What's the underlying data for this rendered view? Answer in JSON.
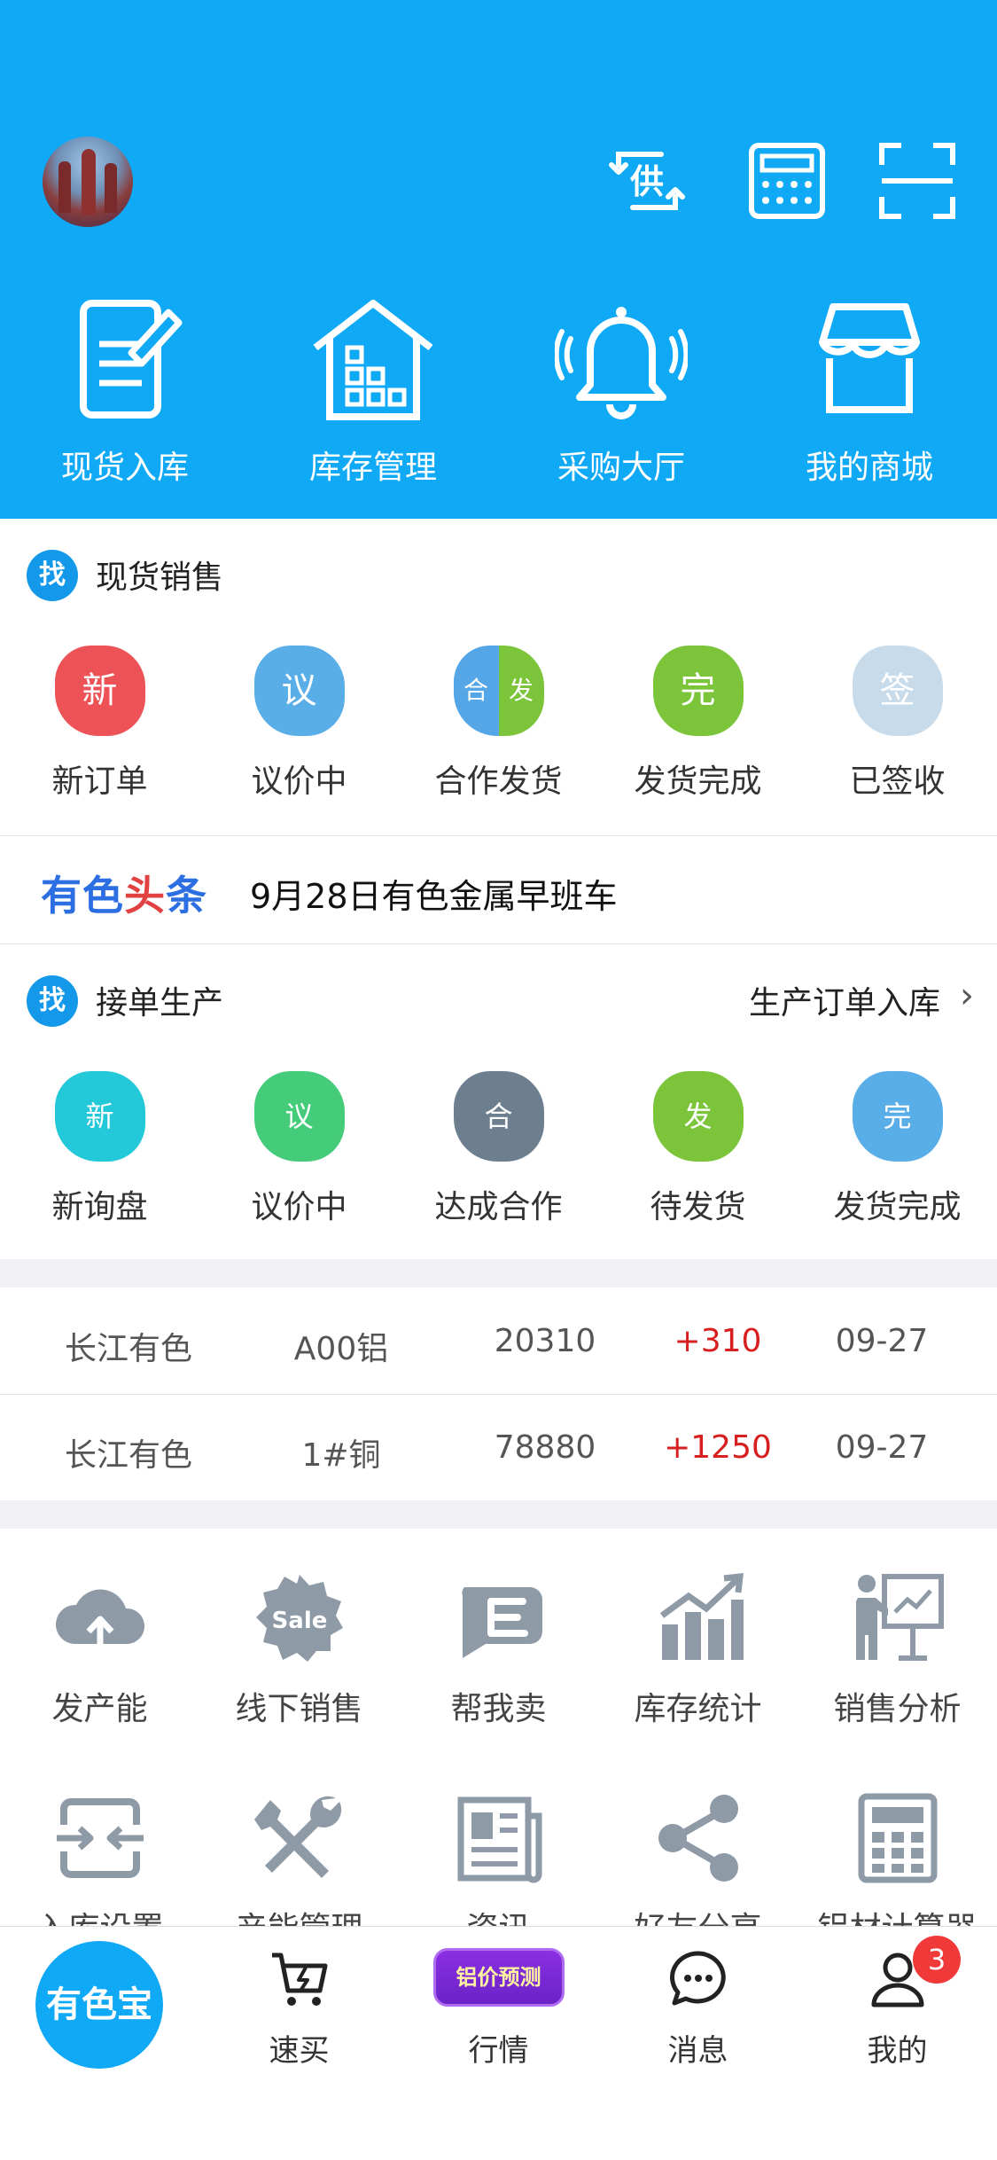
{
  "header": {
    "avatar_alt": "avatar",
    "icons": {
      "supply": "supply-swap-icon",
      "calculator": "calculator-icon",
      "scan": "scan-icon",
      "supply_char": "供"
    },
    "quick_actions": [
      {
        "label": "现货入库",
        "icon": "edit-document-icon"
      },
      {
        "label": "库存管理",
        "icon": "warehouse-icon"
      },
      {
        "label": "采购大厅",
        "icon": "bell-icon"
      },
      {
        "label": "我的商城",
        "icon": "shop-icon"
      }
    ]
  },
  "spot_sales": {
    "badge": "找",
    "title": "现货销售",
    "statuses": [
      {
        "glyph": "新",
        "label": "新订单",
        "color": "#ed5257"
      },
      {
        "glyph": "议",
        "label": "议价中",
        "color": "#59aee8"
      },
      {
        "glyph_left": "合",
        "glyph_right": "发",
        "label": "合作发货"
      },
      {
        "glyph": "完",
        "label": "发货完成",
        "color": "#7cc43a"
      },
      {
        "glyph": "签",
        "label": "已签收",
        "color": "#c8dbea"
      }
    ]
  },
  "news": {
    "logo_a": "有色",
    "logo_b": "头",
    "logo_c": "条",
    "headline": "9月28日有色金属早班车"
  },
  "production": {
    "badge": "找",
    "title": "接单生产",
    "link": "生产订单入库",
    "chevron": "›",
    "statuses": [
      {
        "glyph": "新",
        "label": "新询盘",
        "color": "#23c9d8"
      },
      {
        "glyph": "议",
        "label": "议价中",
        "color": "#45cc7b"
      },
      {
        "glyph": "合",
        "label": "达成合作",
        "color": "#6d7f8f"
      },
      {
        "glyph": "发",
        "label": "待发货",
        "color": "#7cc43a"
      },
      {
        "glyph": "完",
        "label": "发货完成",
        "color": "#59aee8"
      }
    ]
  },
  "prices": [
    {
      "source": "长江有色",
      "metal": "A00铝",
      "price": "20310",
      "change": "+310",
      "date": "09-27"
    },
    {
      "source": "长江有色",
      "metal": "1#铜",
      "price": "78880",
      "change": "+1250",
      "date": "09-27"
    }
  ],
  "tools": [
    {
      "label": "发产能",
      "icon": "cloud-upload-icon"
    },
    {
      "label": "线下销售",
      "icon": "sale-badge-icon",
      "icon_text": "Sale"
    },
    {
      "label": "帮我卖",
      "icon": "help-sell-icon"
    },
    {
      "label": "库存统计",
      "icon": "bar-chart-icon"
    },
    {
      "label": "销售分析",
      "icon": "presentation-icon"
    },
    {
      "label": "入库设置",
      "icon": "merge-arrows-icon"
    },
    {
      "label": "产能管理",
      "icon": "tools-icon"
    },
    {
      "label": "资讯",
      "icon": "newspaper-icon"
    },
    {
      "label": "好友分享",
      "icon": "share-icon"
    },
    {
      "label": "铝材计算器",
      "icon": "calculator-icon"
    }
  ],
  "tabbar": {
    "home": "有色宝",
    "tabs": [
      {
        "label": "速买",
        "icon": "cart-icon"
      },
      {
        "label": "行情",
        "pill": "铝价预测"
      },
      {
        "label": "消息",
        "icon": "chat-icon"
      },
      {
        "label": "我的",
        "icon": "user-icon",
        "badge": "3"
      }
    ]
  },
  "colors": {
    "brand_blue": "#10a9f6",
    "price_up": "#d81f1f"
  }
}
